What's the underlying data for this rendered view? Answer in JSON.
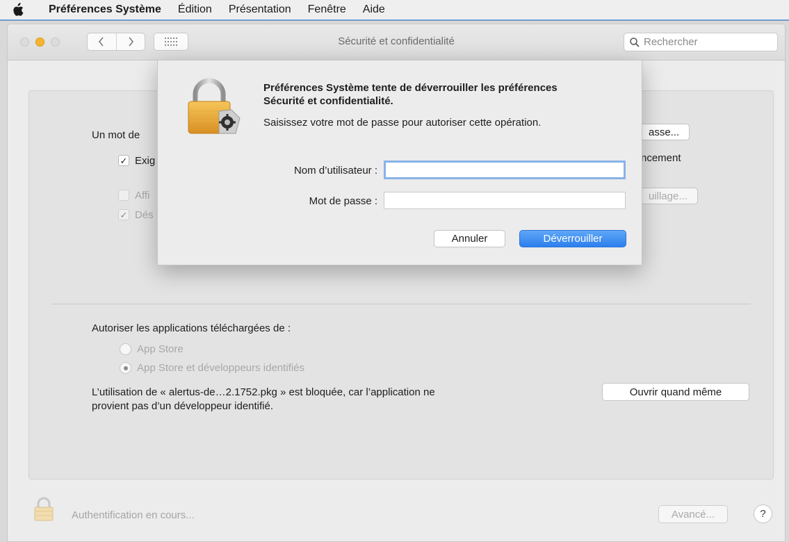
{
  "menubar": {
    "apple_icon": "apple-logo-icon",
    "app_name": "Préférences Système",
    "items": [
      "Édition",
      "Présentation",
      "Fenêtre",
      "Aide"
    ]
  },
  "window": {
    "title": "Sécurité et confidentialité",
    "search_placeholder": "Rechercher"
  },
  "general": {
    "password_label_partial": "Un mot de",
    "require_label_partial": "Exig",
    "require_checked": true,
    "change_password_button_partial": "asse...",
    "delay_suffix_partial": "ncement",
    "show_message_partial": "Affi",
    "show_message_checked": false,
    "disable_partial": "Dés",
    "disable_checked": true,
    "set_lock_message_button_partial": "uillage..."
  },
  "apps": {
    "heading": "Autoriser les applications téléchargées de :",
    "options": [
      {
        "label": "App Store",
        "selected": false
      },
      {
        "label": "App Store et développeurs identifiés",
        "selected": true
      }
    ],
    "blocked_message_line1": "L’utilisation de « alertus-de…2.1752.pkg » est bloquée, car l’application ne",
    "blocked_message_line2": "provient pas d’un développeur identifié.",
    "open_anyway_button": "Ouvrir quand même"
  },
  "footer": {
    "status": "Authentification en cours...",
    "advanced_button": "Avancé...",
    "help_button": "?"
  },
  "dialog": {
    "title": "Préférences Système tente de déverrouiller les préférences Sécurité et confidentialité.",
    "message": "Saisissez votre mot de passe pour autoriser cette opération.",
    "username_label": "Nom d’utilisateur :",
    "username_value": "",
    "password_label": "Mot de passe :",
    "password_value": "",
    "cancel_button": "Annuler",
    "unlock_button": "Déverrouiller"
  },
  "colors": {
    "accent": "#2d7fec",
    "lock_gold": "#e8a83a",
    "traffic_yellow": "#f5b431"
  }
}
